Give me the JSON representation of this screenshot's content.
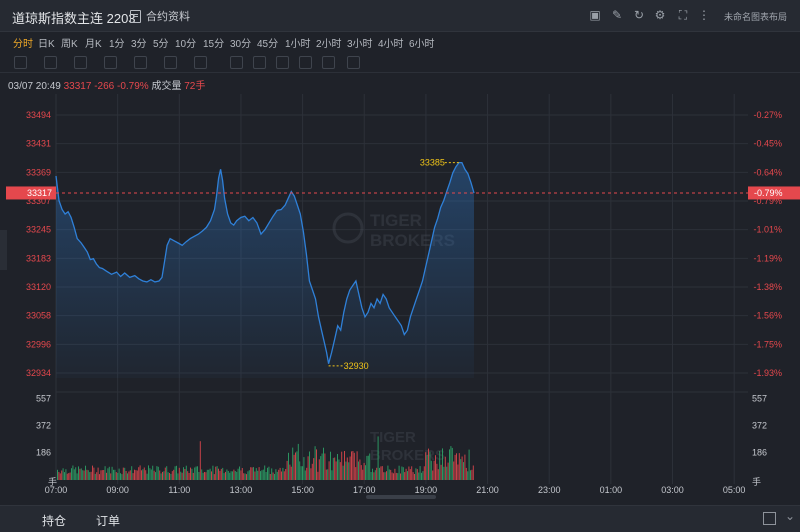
{
  "window": {
    "title": "道琼斯指数主连 2203",
    "contract_info": "合约资料",
    "layout_name": "未命名图表布局"
  },
  "toolbar_icons": [
    "indicator-icon",
    "draw-icon",
    "refresh-icon",
    "settings-icon",
    "fullscreen-icon",
    "more-icon"
  ],
  "periods": [
    "分时",
    "日K",
    "周K",
    "月K",
    "1分",
    "3分",
    "5分",
    "10分",
    "15分",
    "30分",
    "45分",
    "1小时",
    "2小时",
    "3小时",
    "4小时",
    "6小时"
  ],
  "active_period": "分时",
  "info": {
    "datetime": "03/07 20:49",
    "price": "33317",
    "change": "-266",
    "change_pct": "-0.79%",
    "volume_label": "成交量",
    "volume": "72手"
  },
  "watermark": {
    "line1": "TIGER",
    "line2": "BROKERS"
  },
  "colors": {
    "up": "#e5484d",
    "down": "#2ea86a",
    "line": "#2f80d8",
    "accent": "#f0a927",
    "annotation": "#f0c419"
  },
  "chart_data": {
    "type": "line",
    "price_axis_ticks": [
      "33494",
      "33431",
      "33369",
      "33307",
      "33245",
      "33183",
      "33120",
      "33058",
      "32996",
      "32934"
    ],
    "percent_axis_ticks": [
      "-0.27%",
      "-0.45%",
      "-0.64%",
      "-0.79%",
      "-1.01%",
      "-1.19%",
      "-1.38%",
      "-1.56%",
      "-1.75%",
      "-1.93%"
    ],
    "current_price_label": "33317",
    "current_pct_label": "-0.79%",
    "high_label": "33385",
    "low_label": "32930",
    "ylim": [
      32903,
      33525
    ],
    "time_ticks": [
      "07:00",
      "09:00",
      "11:00",
      "13:00",
      "15:00",
      "17:00",
      "19:00",
      "21:00",
      "23:00",
      "01:00",
      "03:00",
      "05:00"
    ],
    "volume_axis_ticks": [
      "557",
      "372",
      "186"
    ],
    "volume_unit": "手",
    "volume_ylim": [
      0,
      600
    ],
    "price_points": [
      [
        0,
        33355
      ],
      [
        3,
        33300
      ],
      [
        6,
        33280
      ],
      [
        9,
        33270
      ],
      [
        12,
        33275
      ],
      [
        15,
        33262
      ],
      [
        18,
        33240
      ],
      [
        21,
        33215
      ],
      [
        25,
        33205
      ],
      [
        28,
        33195
      ],
      [
        31,
        33185
      ],
      [
        34,
        33168
      ],
      [
        37,
        33170
      ],
      [
        40,
        33158
      ],
      [
        43,
        33150
      ],
      [
        46,
        33148
      ],
      [
        50,
        33142
      ],
      [
        55,
        33135
      ],
      [
        60,
        33140
      ],
      [
        64,
        33130
      ],
      [
        68,
        33138
      ],
      [
        73,
        33128
      ],
      [
        78,
        33132
      ],
      [
        82,
        33125
      ],
      [
        86,
        33120
      ],
      [
        90,
        33118
      ],
      [
        94,
        33123
      ],
      [
        98,
        33118
      ],
      [
        102,
        33120
      ],
      [
        105,
        33128
      ],
      [
        108,
        33170
      ],
      [
        110,
        33200
      ],
      [
        113,
        33215
      ],
      [
        117,
        33210
      ],
      [
        121,
        33205
      ],
      [
        125,
        33200
      ],
      [
        129,
        33208
      ],
      [
        133,
        33215
      ],
      [
        137,
        33220
      ],
      [
        141,
        33225
      ],
      [
        145,
        33232
      ],
      [
        149,
        33240
      ],
      [
        153,
        33255
      ],
      [
        157,
        33280
      ],
      [
        159,
        33310
      ],
      [
        161,
        33350
      ],
      [
        163,
        33370
      ],
      [
        165,
        33345
      ],
      [
        167,
        33305
      ],
      [
        170,
        33270
      ],
      [
        173,
        33250
      ],
      [
        176,
        33245
      ],
      [
        179,
        33255
      ],
      [
        183,
        33262
      ],
      [
        187,
        33265
      ],
      [
        191,
        33255
      ],
      [
        195,
        33262
      ],
      [
        199,
        33250
      ],
      [
        203,
        33225
      ],
      [
        207,
        33235
      ],
      [
        211,
        33250
      ],
      [
        215,
        33265
      ],
      [
        219,
        33278
      ],
      [
        223,
        33280
      ],
      [
        227,
        33290
      ],
      [
        230,
        33305
      ],
      [
        233,
        33320
      ],
      [
        236,
        33310
      ],
      [
        239,
        33290
      ],
      [
        242,
        33270
      ],
      [
        245,
        33230
      ],
      [
        248,
        33180
      ],
      [
        251,
        33120
      ],
      [
        254,
        33100
      ],
      [
        257,
        33080
      ],
      [
        260,
        33040
      ],
      [
        263,
        33010
      ],
      [
        266,
        32980
      ],
      [
        268,
        32960
      ],
      [
        270,
        32935
      ],
      [
        273,
        32960
      ],
      [
        276,
        32990
      ],
      [
        279,
        33020
      ],
      [
        282,
        33010
      ],
      [
        285,
        33050
      ],
      [
        288,
        33080
      ],
      [
        291,
        33100
      ],
      [
        294,
        33110
      ],
      [
        297,
        33120
      ],
      [
        300,
        33090
      ],
      [
        303,
        33060
      ],
      [
        306,
        33040
      ],
      [
        309,
        33050
      ],
      [
        312,
        33070
      ],
      [
        315,
        33060
      ],
      [
        318,
        33080
      ],
      [
        321,
        33070
      ],
      [
        324,
        33090
      ],
      [
        327,
        33080
      ],
      [
        330,
        33060
      ],
      [
        333,
        33050
      ],
      [
        336,
        33040
      ],
      [
        339,
        33030
      ],
      [
        342,
        33020
      ],
      [
        345,
        33000
      ],
      [
        348,
        33010
      ],
      [
        351,
        33040
      ],
      [
        354,
        33060
      ],
      [
        357,
        33080
      ],
      [
        360,
        33100
      ],
      [
        363,
        33120
      ],
      [
        366,
        33150
      ],
      [
        369,
        33180
      ],
      [
        372,
        33210
      ],
      [
        375,
        33240
      ],
      [
        378,
        33260
      ],
      [
        381,
        33285
      ],
      [
        384,
        33300
      ],
      [
        387,
        33320
      ],
      [
        390,
        33340
      ],
      [
        393,
        33362
      ],
      [
        396,
        33375
      ],
      [
        399,
        33385
      ],
      [
        402,
        33385
      ],
      [
        405,
        33370
      ],
      [
        408,
        33360
      ],
      [
        411,
        33340
      ],
      [
        414,
        33317
      ]
    ]
  }
}
